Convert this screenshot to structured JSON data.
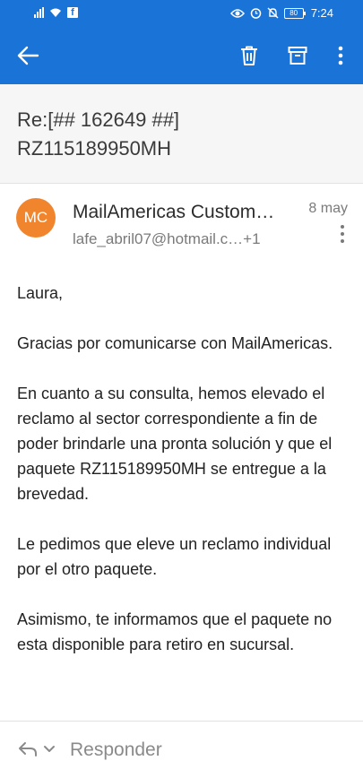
{
  "status_bar": {
    "time": "7:24",
    "battery_text": "80"
  },
  "app_bar": {
    "icons": [
      "back-arrow-icon",
      "delete-icon",
      "archive-icon",
      "more-vertical-icon"
    ]
  },
  "subject": {
    "line1": "Re:[## 162649 ##]",
    "line2": "RZ115189950MH"
  },
  "message": {
    "avatar_initials": "MC",
    "avatar_color": "#f0852d",
    "sender_name": "MailAmericas Custom…",
    "recipient": "lafe_abril07@hotmail.c…+1",
    "date": "8 may",
    "paragraphs": [
      "Laura,",
      "Gracias por comunicarse con MailAmericas.",
      "En cuanto a su consulta, hemos elevado el reclamo al sector correspondiente a fin de poder brindarle una pronta solución y que el paquete RZ115189950MH se entregue a la brevedad.",
      "Le pedimos que eleve un reclamo individual por el otro paquete.",
      "Asimismo, te informamos que el paquete no esta disponible para retiro en sucursal."
    ]
  },
  "reply_bar": {
    "label": "Responder"
  },
  "colors": {
    "accent": "#1a73d6",
    "subject_bg": "#f6f6f6"
  }
}
